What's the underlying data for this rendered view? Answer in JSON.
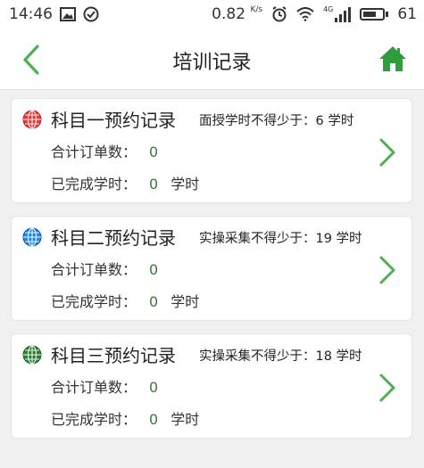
{
  "status_bar": {
    "time": "14:46",
    "net_speed": "0.82",
    "net_unit": "K/s",
    "network_type": "4G",
    "battery": "61",
    "icons": [
      "image-icon",
      "check-circle-icon",
      "alarm-icon",
      "wifi-icon",
      "signal-icon",
      "battery-icon"
    ]
  },
  "header": {
    "title": "培训记录",
    "back_icon": "chevron-left-icon",
    "home_icon": "home-icon"
  },
  "colors": {
    "accent_green": "#4caf50",
    "value_green": "#2e7d32",
    "globe_red": "#e53935",
    "globe_blue": "#1e88e5",
    "globe_green": "#2e7d32"
  },
  "cards": [
    {
      "title": "科目一预约记录",
      "requirement": "面授学时不得少于：6 学时",
      "orders_label": "合计订单数：",
      "orders_value": "0",
      "hours_label": "已完成学时：",
      "hours_value": "0",
      "hours_unit": "学时",
      "globe_color": "red"
    },
    {
      "title": "科目二预约记录",
      "requirement": "实操采集不得少于：19 学时",
      "orders_label": "合计订单数：",
      "orders_value": "0",
      "hours_label": "已完成学时：",
      "hours_value": "0",
      "hours_unit": "学时",
      "globe_color": "blue"
    },
    {
      "title": "科目三预约记录",
      "requirement": "实操采集不得少于：18 学时",
      "orders_label": "合计订单数：",
      "orders_value": "0",
      "hours_label": "已完成学时：",
      "hours_value": "0",
      "hours_unit": "学时",
      "globe_color": "green"
    }
  ]
}
